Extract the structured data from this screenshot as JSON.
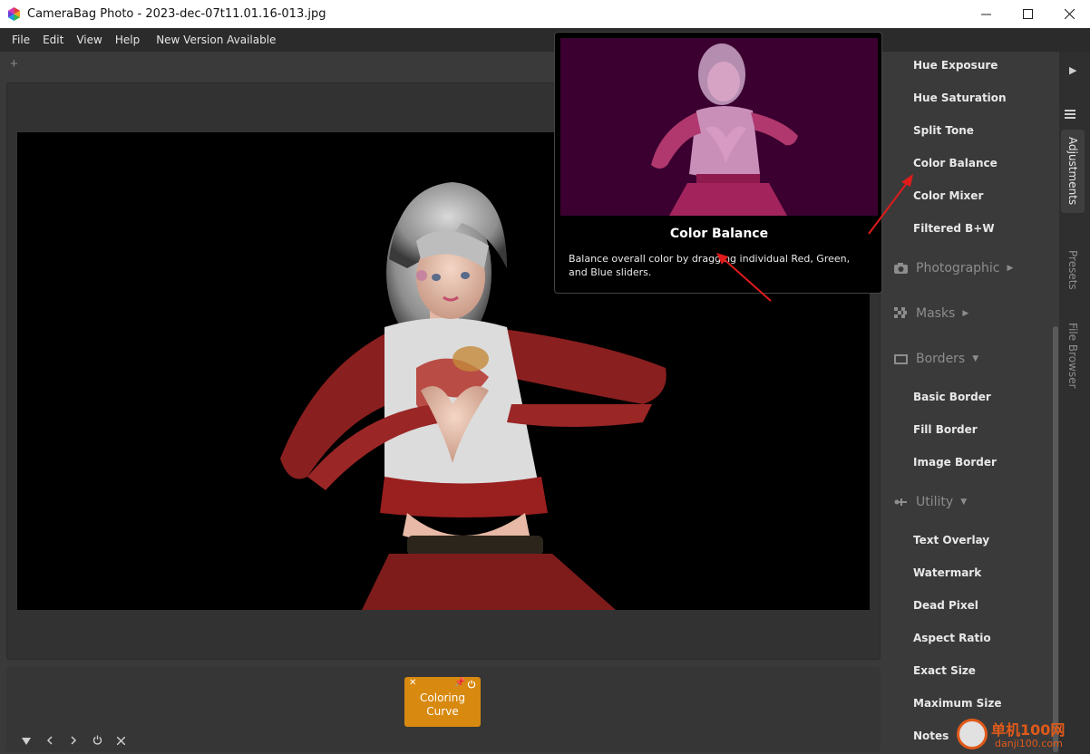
{
  "window": {
    "title": "CameraBag Photo - 2023-dec-07t11.01.16-013.jpg",
    "controls": [
      "minimize",
      "maximize",
      "close"
    ]
  },
  "menu": {
    "items": [
      "File",
      "Edit",
      "View",
      "Help",
      "New Version Available"
    ]
  },
  "tabs": {
    "add_label": "+"
  },
  "tooltip": {
    "title": "Color Balance",
    "description": "Balance overall color by dragging individual Red, Green, and Blue sliders."
  },
  "adjustments": {
    "items_top": [
      "Hue Exposure",
      "Hue Saturation",
      "Split Tone",
      "Color Balance",
      "Color Mixer",
      "Filtered B+W"
    ],
    "sections": {
      "photographic": "Photographic",
      "masks": "Masks",
      "borders": "Borders",
      "utility": "Utility"
    },
    "border_items": [
      "Basic Border",
      "Fill Border",
      "Image Border"
    ],
    "utility_items": [
      "Text Overlay",
      "Watermark",
      "Dead Pixel",
      "Aspect Ratio",
      "Exact Size",
      "Maximum Size",
      "Notes"
    ]
  },
  "side_tabs": [
    "Adjustments",
    "Presets",
    "File Browser"
  ],
  "active_side_tab": "Adjustments",
  "filter_strip": {
    "card_label_line1": "Coloring",
    "card_label_line2": "Curve",
    "card_color": "#d8890f"
  },
  "colors": {
    "accent": "#d8890f",
    "annotation_arrow": "#e01b1b",
    "panel": "#3a3a3a"
  },
  "watermark": {
    "line1": "单机100网",
    "line2": "danji100.com"
  }
}
